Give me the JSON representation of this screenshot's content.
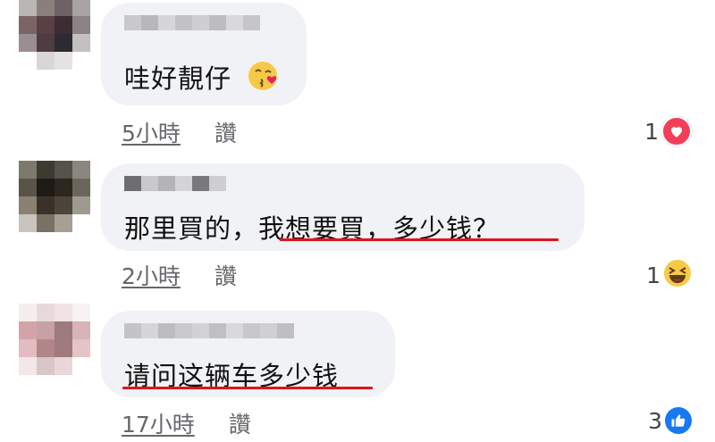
{
  "comments": [
    {
      "text": "哇好靚仔",
      "time": "5小時",
      "like_label": "讚",
      "reaction_count": "1",
      "reaction": "heart-icon"
    },
    {
      "text": "那里買的，我想要買，多少钱？",
      "time": "2小時",
      "like_label": "讚",
      "reaction_count": "1",
      "reaction": "laugh-emoji-icon"
    },
    {
      "text": "请问这辆车多少钱",
      "time": "17小時",
      "like_label": "讚",
      "reaction_count": "3",
      "reaction": "thumbs-up-icon"
    }
  ],
  "colors": {
    "bubble": "#f0f2f5",
    "annotation_underline": "#e0141e",
    "meta_text": "#65676b",
    "heart": "#f33e58",
    "like_blue": "#1877f2",
    "haha_yellow": "#f7c948"
  }
}
